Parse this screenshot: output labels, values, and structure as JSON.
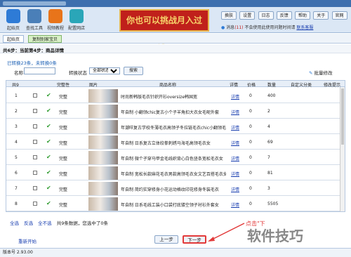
{
  "window": {
    "title": ""
  },
  "toolbar": {
    "tools": [
      {
        "label": "起始页",
        "icon": "home-icon",
        "color": "#2e7bd6"
      },
      {
        "label": "查找工具",
        "icon": "search-icon",
        "color": "#4a7fb8"
      },
      {
        "label": "视频教程",
        "icon": "video-icon",
        "color": "#e8741a"
      },
      {
        "label": "配置网店",
        "icon": "gear-icon",
        "color": "#2aa6b8"
      }
    ],
    "banner": "你也可以挑战月入过万!",
    "buttons": [
      "换肤",
      "设置",
      "日志",
      "反馈",
      "帮助",
      "关于",
      "官网"
    ],
    "message_prefix": "消息",
    "message_count": "(11)",
    "message_text": "不会使用此使用问题时间请",
    "message_link": "联系客服"
  },
  "tabs": [
    {
      "label": "起始页",
      "active": false
    },
    {
      "label": "复制别家宝贝",
      "active": true
    }
  ],
  "breadcrumb": "共6步：当前第4步：商品详情",
  "status": "已转换23条，未转换0条",
  "filters": {
    "name_label": "名称",
    "convert_label": "转换状态",
    "convert_value": "全部状态",
    "search_label": "搜索"
  },
  "batch_label": "批量修改",
  "table": {
    "headers": [
      "共9",
      "",
      "",
      "完整性",
      "图片",
      "商品名称",
      "详情",
      "价格",
      "数量",
      "自定义分类",
      "修改提示"
    ],
    "rows": [
      {
        "num": "1",
        "status": "完整",
        "title": "时尚新韩版毛衣针织开衫oversize韩国宽",
        "detail": "详情",
        "price": "0",
        "qty": "400"
      },
      {
        "num": "2",
        "status": "完整",
        "title": "年自制 小翻领chic复古小个子羊角扣大衣女毛呢外套",
        "detail": "详情",
        "price": "0",
        "qty": "2"
      },
      {
        "num": "3",
        "status": "完整",
        "title": "年潮咩复古学校冬薄毛衣高领子冬拉链毛衣chic小翻领毛衣",
        "detail": "详情",
        "price": "0",
        "qty": "4"
      },
      {
        "num": "4",
        "status": "完整",
        "title": "年自制 日系复古立体绞拳刺绣马海毛高领毛衣女",
        "detail": "详情",
        "price": "0",
        "qty": "69"
      },
      {
        "num": "5",
        "status": "完整",
        "title": "年自制 微个子穿马甲金毛线织背心白色竖条宽松毛衣女",
        "detail": "详情",
        "price": "0",
        "qty": "7"
      },
      {
        "num": "6",
        "status": "完整",
        "title": "年自制 宽松长款麻花毛衣男款高领毛衣女文艺百搭毛衣女",
        "detail": "详情",
        "price": "0",
        "qty": "81"
      },
      {
        "num": "7",
        "status": "完整",
        "title": "年自制 简约实穿修身小花运动格纹印花修身冬装毛衣",
        "detail": "详情",
        "price": "0",
        "qty": "3"
      },
      {
        "num": "8",
        "status": "完整",
        "title": "年自制 日系毛线工装小口袋打底镂空领子衬衫外套女",
        "detail": "详情",
        "price": "0",
        "qty": "5505"
      }
    ]
  },
  "selection": {
    "select_all": "全选",
    "invert": "反选",
    "none": "全不选",
    "info": "共9条数据，您选中了0条"
  },
  "restart": "重新开始",
  "prev": "上一步",
  "next": "下一步",
  "hint": "点击\"下",
  "watermark": "软件技巧",
  "footer": "版本号 2.93.00"
}
